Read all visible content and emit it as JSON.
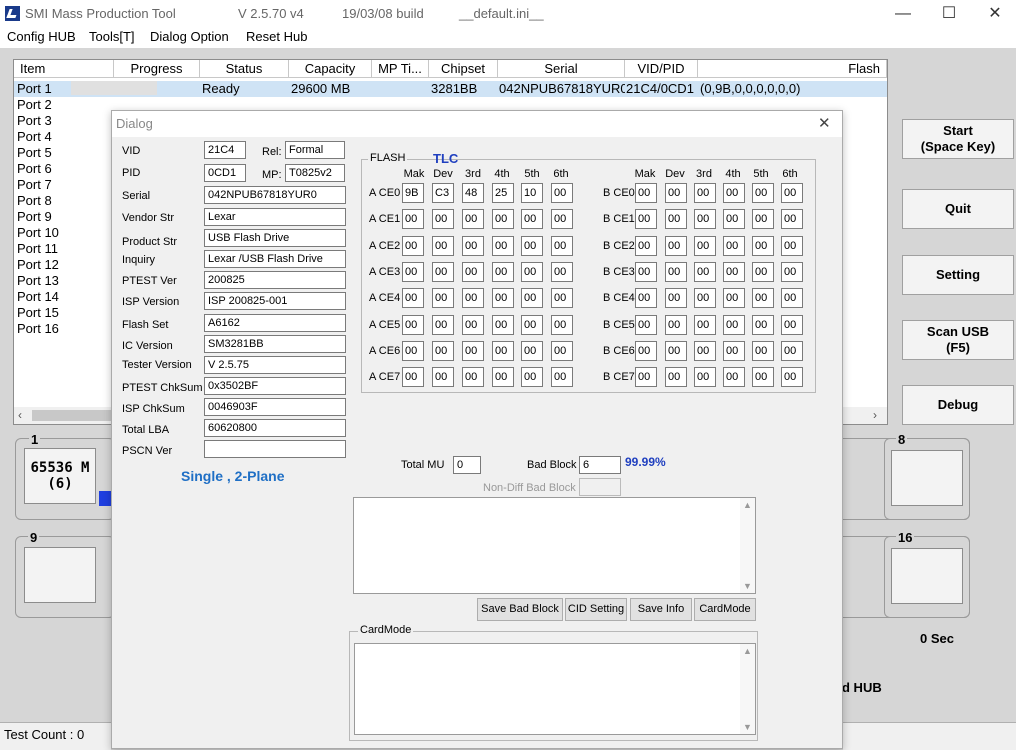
{
  "window": {
    "title": "SMI Mass Production Tool",
    "version": "V 2.5.70   v4",
    "build": "19/03/08 build",
    "ini": "__default.ini__"
  },
  "menu": [
    "Config HUB",
    "Tools[T]",
    "Dialog Option",
    "Reset Hub"
  ],
  "table": {
    "headers": [
      "Item",
      "Progress",
      "Status",
      "Capacity",
      "MP Ti...",
      "Chipset",
      "Serial",
      "VID/PID",
      "Flash"
    ],
    "ports": [
      "Port 1",
      "Port 2",
      "Port 3",
      "Port 4",
      "Port 5",
      "Port 6",
      "Port 7",
      "Port 8",
      "Port 9",
      "Port 10",
      "Port 11",
      "Port 12",
      "Port 13",
      "Port 14",
      "Port 15",
      "Port 16"
    ],
    "row1": {
      "status": "Ready",
      "capacity": "29600 MB",
      "chipset": "3281BB",
      "serial": "042NPUB67818YUR0",
      "vidpid": "21C4/0CD1",
      "flash": "(0,9B,0,0,0,0,0,0)"
    }
  },
  "buttons": {
    "start": "Start\n(Space Key)",
    "quit": "Quit",
    "setting": "Setting",
    "scan": "Scan USB\n(F5)",
    "debug": "Debug"
  },
  "panels": {
    "p1": "1",
    "p1_text": "65536 M\n(6)",
    "p8": "8",
    "p9": "9",
    "p16": "16",
    "timer": "0 Sec",
    "hub": "d HUB"
  },
  "status_bar": "Test Count : 0",
  "dialog": {
    "title": "Dialog",
    "vid_label": "VID",
    "vid": "21C4",
    "rel_label": "Rel:",
    "rel": "Formal",
    "pid_label": "PID",
    "pid": "0CD1",
    "mp_label": "MP:",
    "mp": "T0825v2",
    "fields": [
      {
        "label": "Serial",
        "value": "042NPUB67818YUR0"
      },
      {
        "label": "Vendor Str",
        "value": "Lexar"
      },
      {
        "label": "Product Str",
        "value": "USB Flash Drive"
      },
      {
        "label": "Inquiry",
        "value": "Lexar   /USB Flash Drive"
      },
      {
        "label": "PTEST Ver",
        "value": "200825"
      },
      {
        "label": "ISP Version",
        "value": "ISP 200825-001"
      },
      {
        "label": "Flash Set",
        "value": "A6162"
      },
      {
        "label": "IC Version",
        "value": "SM3281BB"
      },
      {
        "label": "Tester Version",
        "value": "V 2.5.75"
      },
      {
        "label": "PTEST ChkSum",
        "value": "0x3502BF"
      },
      {
        "label": "ISP ChkSum",
        "value": "0046903F"
      },
      {
        "label": "Total LBA",
        "value": "60620800"
      },
      {
        "label": "PSCN Ver",
        "value": ""
      }
    ],
    "plane": "Single , 2-Plane",
    "flash_group": "FLASH",
    "flash_type": "TLC",
    "col_headers": [
      "Mak",
      "Dev",
      "3rd",
      "4th",
      "5th",
      "6th"
    ],
    "a_rows": [
      {
        "label": "A CE0",
        "cells": [
          "9B",
          "C3",
          "48",
          "25",
          "10",
          "00"
        ]
      },
      {
        "label": "A CE1",
        "cells": [
          "00",
          "00",
          "00",
          "00",
          "00",
          "00"
        ]
      },
      {
        "label": "A CE2",
        "cells": [
          "00",
          "00",
          "00",
          "00",
          "00",
          "00"
        ]
      },
      {
        "label": "A CE3",
        "cells": [
          "00",
          "00",
          "00",
          "00",
          "00",
          "00"
        ]
      },
      {
        "label": "A CE4",
        "cells": [
          "00",
          "00",
          "00",
          "00",
          "00",
          "00"
        ]
      },
      {
        "label": "A CE5",
        "cells": [
          "00",
          "00",
          "00",
          "00",
          "00",
          "00"
        ]
      },
      {
        "label": "A CE6",
        "cells": [
          "00",
          "00",
          "00",
          "00",
          "00",
          "00"
        ]
      },
      {
        "label": "A CE7",
        "cells": [
          "00",
          "00",
          "00",
          "00",
          "00",
          "00"
        ]
      }
    ],
    "b_rows": [
      {
        "label": "B CE0",
        "cells": [
          "00",
          "00",
          "00",
          "00",
          "00",
          "00"
        ]
      },
      {
        "label": "B CE1",
        "cells": [
          "00",
          "00",
          "00",
          "00",
          "00",
          "00"
        ]
      },
      {
        "label": "B CE2",
        "cells": [
          "00",
          "00",
          "00",
          "00",
          "00",
          "00"
        ]
      },
      {
        "label": "B CE3",
        "cells": [
          "00",
          "00",
          "00",
          "00",
          "00",
          "00"
        ]
      },
      {
        "label": "B CE4",
        "cells": [
          "00",
          "00",
          "00",
          "00",
          "00",
          "00"
        ]
      },
      {
        "label": "B CE5",
        "cells": [
          "00",
          "00",
          "00",
          "00",
          "00",
          "00"
        ]
      },
      {
        "label": "B CE6",
        "cells": [
          "00",
          "00",
          "00",
          "00",
          "00",
          "00"
        ]
      },
      {
        "label": "B CE7",
        "cells": [
          "00",
          "00",
          "00",
          "00",
          "00",
          "00"
        ]
      }
    ],
    "total_mu_label": "Total MU",
    "total_mu": "0",
    "bad_block_label": "Bad Block",
    "bad_block": "6",
    "percent": "99.99%",
    "non_diff_label": "Non-Diff Bad Block",
    "non_diff": "",
    "btn_save_bad": "Save Bad Block",
    "btn_cid": "CID Setting",
    "btn_save_info": "Save Info",
    "btn_cardmode": "CardMode",
    "cardmode_group": "CardMode"
  },
  "colors": {
    "accent_blue": "#1f6fc5",
    "tlc_blue": "#1f3fbf",
    "selection": "#cfe3f5"
  }
}
